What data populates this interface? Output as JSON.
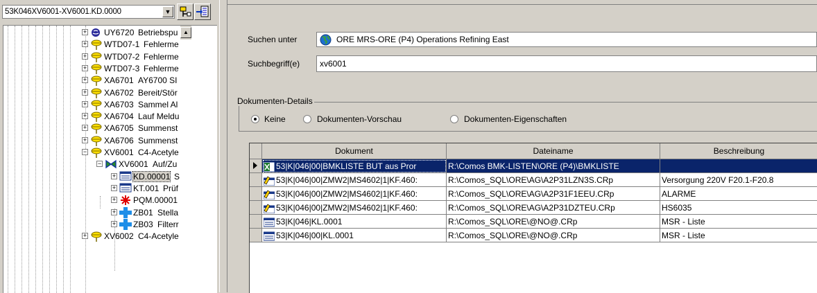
{
  "left_pane": {
    "combo_value": "53K046XV6001-XV6001.KD.0000",
    "tree_items": [
      {
        "code": "UY6720",
        "label": "Betriebspu",
        "icon": "blue-globe-icon",
        "indent": 0
      },
      {
        "code": "WTD07-1",
        "label": "Fehlerme",
        "icon": "yellow-pin-icon",
        "indent": 0
      },
      {
        "code": "WTD07-2",
        "label": "Fehlerme",
        "icon": "yellow-pin-icon",
        "indent": 0
      },
      {
        "code": "WTD07-3",
        "label": "Fehlerme",
        "icon": "yellow-pin-icon",
        "indent": 0
      },
      {
        "code": "XA6701",
        "label": "AY6700 SI",
        "icon": "yellow-pin-icon",
        "indent": 0
      },
      {
        "code": "XA6702",
        "label": "Bereit/Stör",
        "icon": "yellow-pin-icon",
        "indent": 0
      },
      {
        "code": "XA6703",
        "label": "Sammel Al",
        "icon": "yellow-pin-icon",
        "indent": 0
      },
      {
        "code": "XA6704",
        "label": "Lauf Meldu",
        "icon": "yellow-pin-icon",
        "indent": 0
      },
      {
        "code": "XA6705",
        "label": "Summenst",
        "icon": "yellow-pin-icon",
        "indent": 0
      },
      {
        "code": "XA6706",
        "label": "Summenst",
        "icon": "yellow-pin-icon",
        "indent": 0
      },
      {
        "code": "XV6001",
        "label": "C4-Acetyle",
        "icon": "yellow-pin-icon",
        "indent": 0
      },
      {
        "code": "XV6001",
        "label": "Auf/Zu",
        "icon": "valve-icon",
        "indent": 1
      },
      {
        "code": "KD.00001",
        "label": "S",
        "icon": "document-icon",
        "indent": 2,
        "selected": true
      },
      {
        "code": "KT.001",
        "label": "Prüf",
        "icon": "document-icon",
        "indent": 2
      },
      {
        "code": "PQM.00001",
        "label": "",
        "icon": "red-burst-icon",
        "indent": 2
      },
      {
        "code": "ZB01",
        "label": "Stella",
        "icon": "blue-cross-icon",
        "indent": 2
      },
      {
        "code": "ZB03",
        "label": "Filterr",
        "icon": "blue-cross-icon",
        "indent": 2
      },
      {
        "code": "XV6002",
        "label": "C4-Acetyle",
        "icon": "yellow-pin-icon",
        "indent": 0
      }
    ]
  },
  "search": {
    "suchen_unter_label": "Suchen unter",
    "suchen_unter_value": "ORE   MRS-ORE (P4) Operations Refining East",
    "suchbegriff_label": "Suchbegriff(e)",
    "suchbegriff_value": "xv6001"
  },
  "details": {
    "group_title": "Dokumenten-Details",
    "options": [
      {
        "label": "Keine",
        "checked": true
      },
      {
        "label": "Dokumenten-Vorschau",
        "checked": false
      },
      {
        "label": "Dokumenten-Eigenschaften",
        "checked": false
      }
    ]
  },
  "grid": {
    "headers": [
      "Dokument",
      "Dateiname",
      "Beschreibung"
    ],
    "rows": [
      {
        "dokument": "53|K|046|00|BMKLISTE BUT aus Pror",
        "dateiname": "R:\\Comos BMK-LISTEN\\ORE (P4)\\BMKLISTE",
        "beschreibung": "",
        "icon": "excel-icon",
        "selected": true
      },
      {
        "dokument": "53|K|046|00|ZMW2|MS4602|1|KF.460:",
        "dateiname": "R:\\Comos_SQL\\ORE\\AG\\A2P31LZN3S.CRp",
        "beschreibung": "Versorgung 220V  F20.1-F20.8",
        "icon": "report-edit-icon"
      },
      {
        "dokument": "53|K|046|00|ZMW2|MS4602|1|KF.460:",
        "dateiname": "R:\\Comos_SQL\\ORE\\AG\\A2P31F1EEU.CRp",
        "beschreibung": "ALARME",
        "icon": "report-edit-icon"
      },
      {
        "dokument": "53|K|046|00|ZMW2|MS4602|1|KF.460:",
        "dateiname": "R:\\Comos_SQL\\ORE\\AG\\A2P31DZTEU.CRp",
        "beschreibung": "HS6035",
        "icon": "report-edit-icon"
      },
      {
        "dokument": "53|K|046|KL.0001",
        "dateiname": "R:\\Comos_SQL\\ORE\\@NO@.CRp",
        "beschreibung": "MSR - Liste",
        "icon": "report-icon"
      },
      {
        "dokument": "53|K|046|00|KL.0001",
        "dateiname": "R:\\Comos_SQL\\ORE\\@NO@.CRp",
        "beschreibung": "MSR - Liste",
        "icon": "report-icon"
      }
    ]
  },
  "colors": {
    "selection": "#0a246a",
    "face": "#d4d0c8"
  }
}
